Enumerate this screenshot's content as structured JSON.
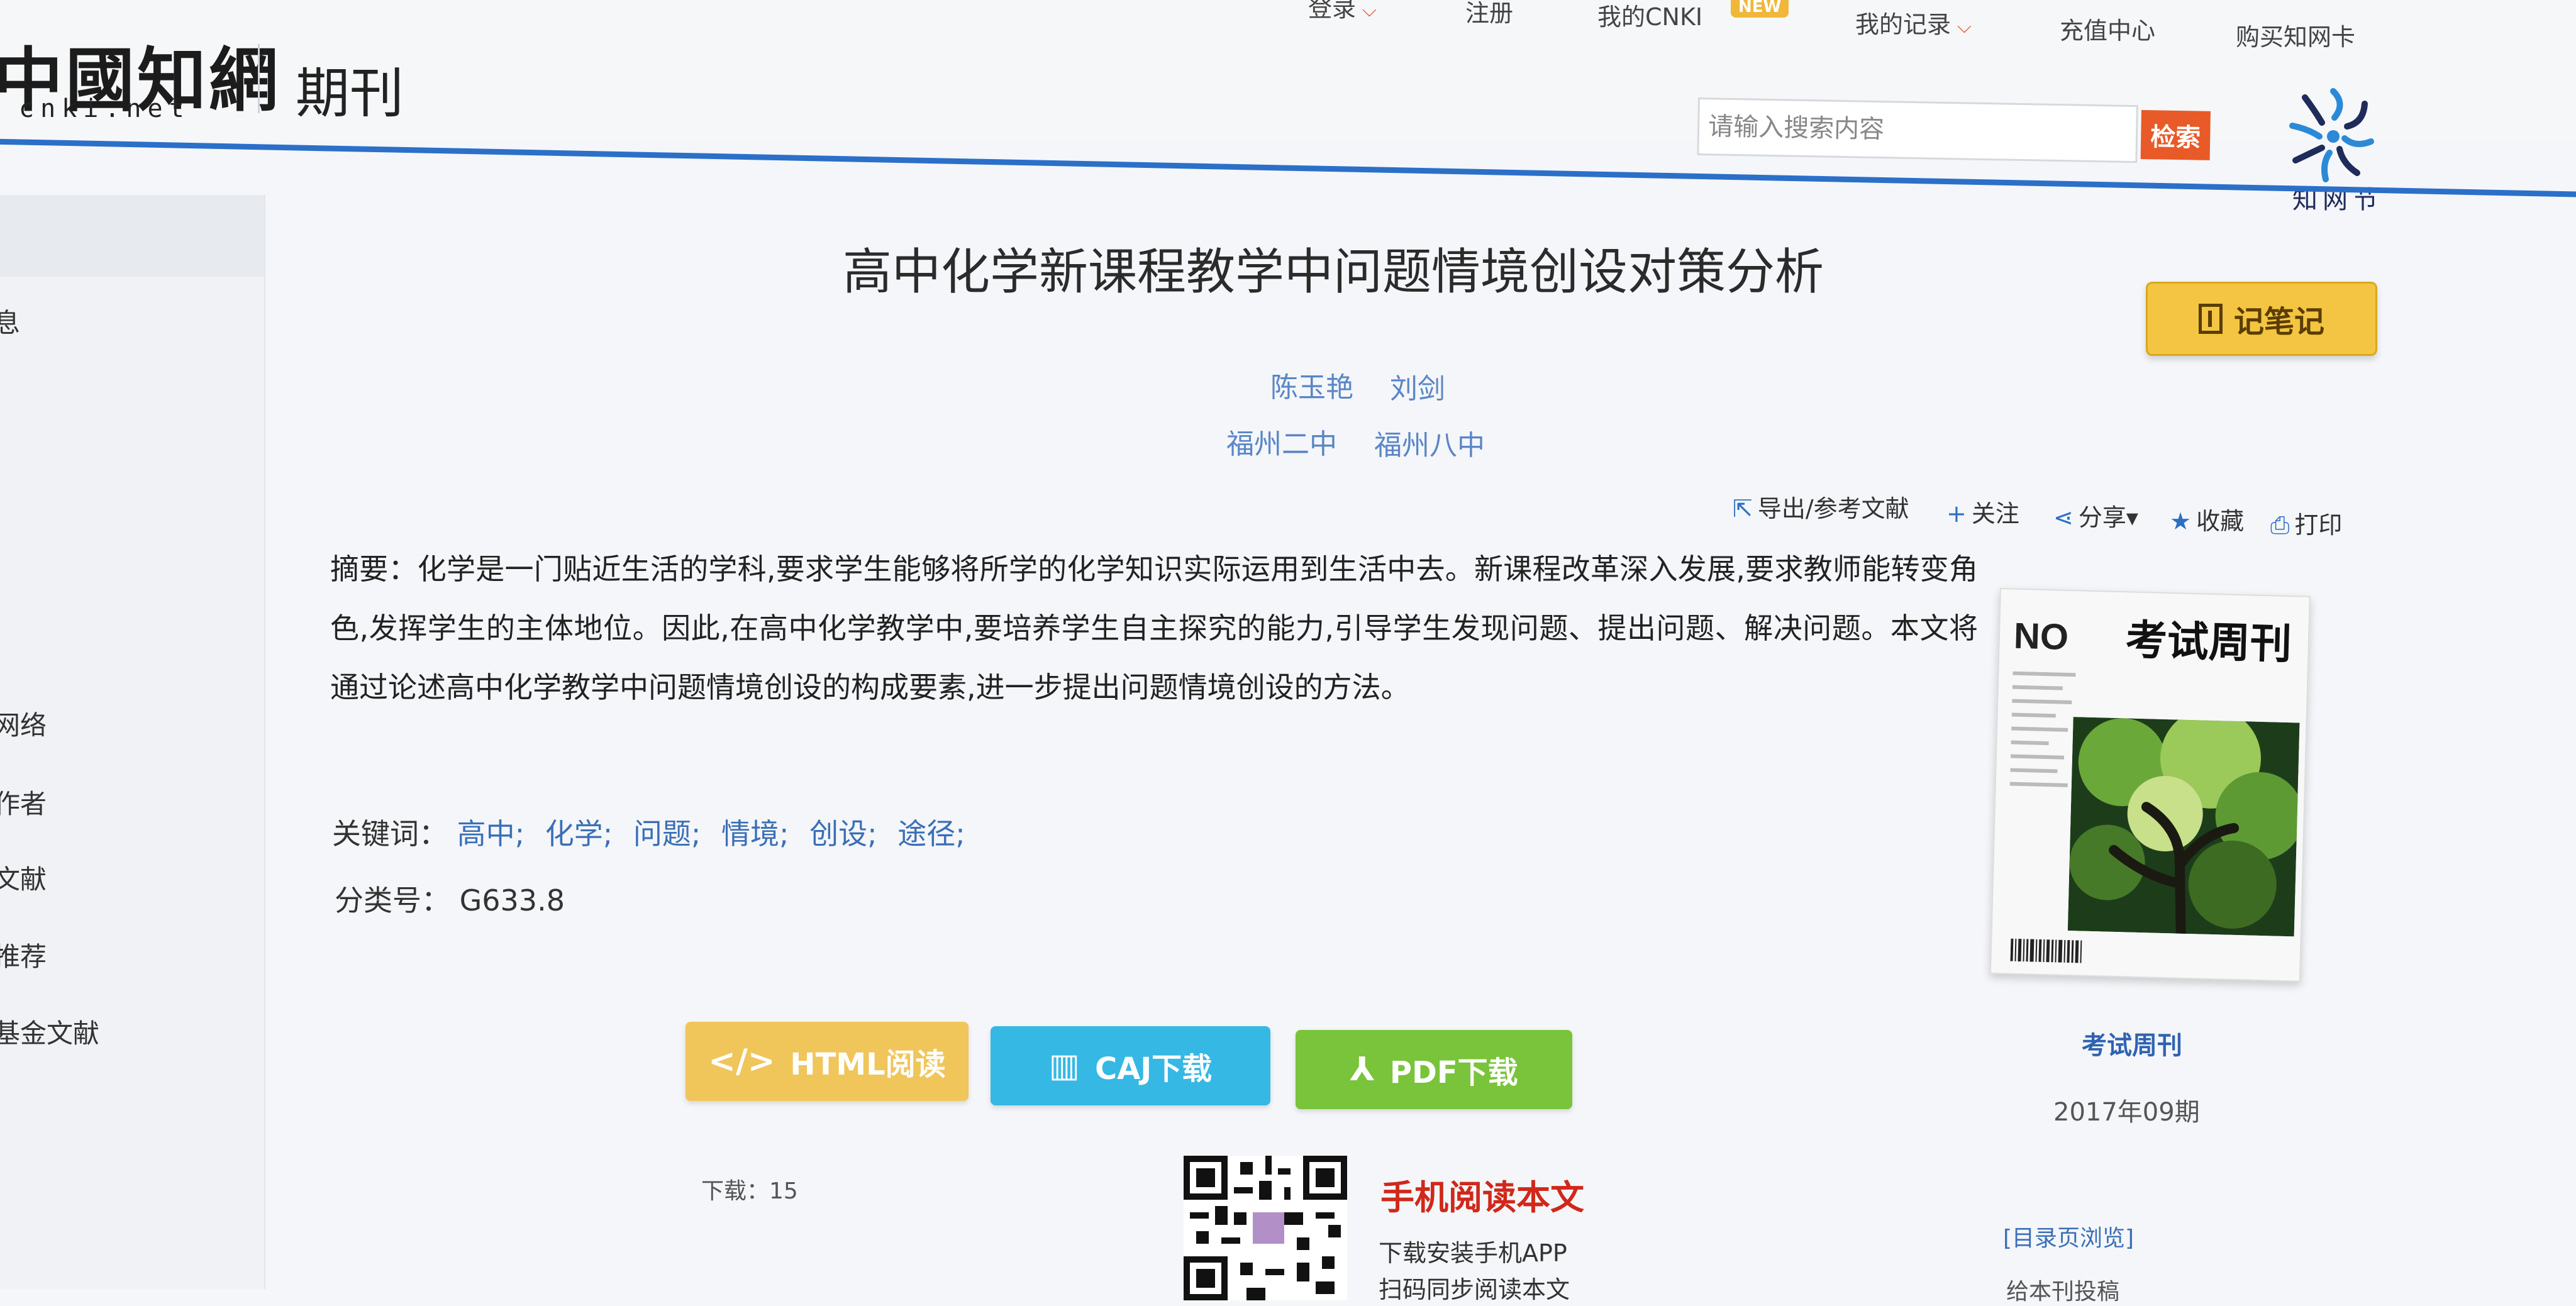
{
  "header": {
    "logo_text": "中國知網",
    "logo_subtext": "cnki.net",
    "section_title": "期刊",
    "top_links": {
      "login": "登录",
      "register": "注册",
      "my_cnki": "我的CNKI",
      "new_badge": "NEW",
      "my_records": "我的记录",
      "recharge": "充值中心",
      "buy_card": "购买知网卡"
    },
    "search": {
      "placeholder": "请输入搜索内容",
      "button_label": "检索"
    },
    "festival_label": "知网节"
  },
  "sidebar": {
    "items": [
      "息",
      "网络",
      "作者",
      "文献",
      "推荐",
      "基金文献"
    ]
  },
  "article": {
    "title": "高中化学新课程教学中问题情境创设对策分析",
    "note_button": "记笔记",
    "authors": [
      "陈玉艳",
      "刘剑"
    ],
    "organizations": [
      "福州二中",
      "福州八中"
    ],
    "tools": {
      "export": "导出/参考文献",
      "follow": "关注",
      "share": "分享",
      "favorite": "收藏",
      "print": "打印"
    },
    "abstract_label": "摘要：",
    "abstract_text": "化学是一门贴近生活的学科,要求学生能够将所学的化学知识实际运用到生活中去。新课程改革深入发展,要求教师能转变角色,发挥学生的主体地位。因此,在高中化学教学中,要培养学生自主探究的能力,引导学生发现问题、提出问题、解决问题。本文将通过论述高中化学教学中问题情境创设的构成要素,进一步提出问题情境创设的方法。",
    "keywords_label": "关键词：",
    "keywords": [
      "高中;",
      "化学;",
      "问题;",
      "情境;",
      "创设;",
      "途径;"
    ],
    "class_label": "分类号：",
    "class_value": "G633.8"
  },
  "read_buttons": {
    "html": "HTML阅读",
    "caj": "CAJ下载",
    "pdf": "PDF下载"
  },
  "stats": {
    "downloads_label": "下载：",
    "downloads_value": "15"
  },
  "mobile": {
    "title": "手机阅读本文",
    "line1": "下载安装手机APP",
    "line2": "扫码同步阅读本文"
  },
  "journal": {
    "cover_no": "NO",
    "cover_title": "考试周刊",
    "name": "考试周刊",
    "issue": "2017年09期",
    "toc_link": "[目录页浏览]",
    "extra_link": "给本刊投稿"
  },
  "colors": {
    "accent_blue": "#2b6fc9",
    "search_button": "#e85a27",
    "note_button": "#f4c542",
    "html_button": "#f0c55a",
    "caj_button": "#35b8e4",
    "pdf_button": "#79c43a",
    "mobile_title": "#d0281a"
  }
}
